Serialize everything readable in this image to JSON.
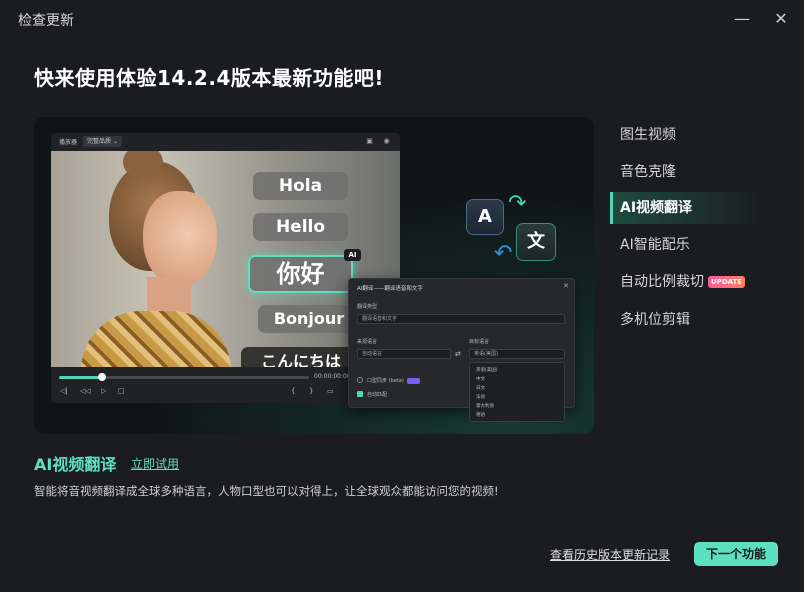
{
  "window": {
    "title": "检查更新",
    "minimize_icon": "minimize-icon",
    "close_icon": "close-icon"
  },
  "headline": "快来使用体验14.2.4版本最新功能吧!",
  "hero": {
    "player": {
      "label": "播放器",
      "quality": "完整品质",
      "timecode": "00:00:00:00",
      "seek_progress": 0.17
    },
    "bubbles": {
      "hola": "Hola",
      "hello": "Hello",
      "nihao": "你好",
      "ai_tag": "AI",
      "bonjour": "Bonjour",
      "konnichiwa": "こんにちは"
    },
    "translate_icon": {
      "left_glyph": "A",
      "right_glyph": "文"
    },
    "dialog": {
      "title": "AI翻译——翻译语音和文字",
      "type_label": "翻译类型",
      "type_value": "翻译语音和文字",
      "source_label": "来源语言",
      "source_value": "自动语言",
      "target_label": "目标语言",
      "target_value": "英语(美国)",
      "lip_sync_label": "口型同步 (beta)",
      "auto_match_label": "自动匹配",
      "target_options": [
        "英语(美国)",
        "中文",
        "日文",
        "法语",
        "意大利语",
        "德语"
      ]
    }
  },
  "sidebar": {
    "items": [
      {
        "label": "图生视频",
        "active": false
      },
      {
        "label": "音色克隆",
        "active": false
      },
      {
        "label": "AI视频翻译",
        "active": true
      },
      {
        "label": "AI智能配乐",
        "active": false
      },
      {
        "label": "自动比例裁切",
        "active": false,
        "badge": "UPDATE"
      },
      {
        "label": "多机位剪辑",
        "active": false
      }
    ]
  },
  "feature": {
    "title": "AI视频翻译",
    "try_label": "立即试用",
    "description": "智能将音视频翻译成全球多种语言，人物口型也可以对得上，让全球观众都能访问您的视频!"
  },
  "footer": {
    "history_label": "查看历史版本更新记录",
    "next_label": "下一个功能"
  },
  "colors": {
    "accent": "#5de0c0",
    "background": "#1b1c1f",
    "badge_gradient_start": "#ff5c9a"
  }
}
